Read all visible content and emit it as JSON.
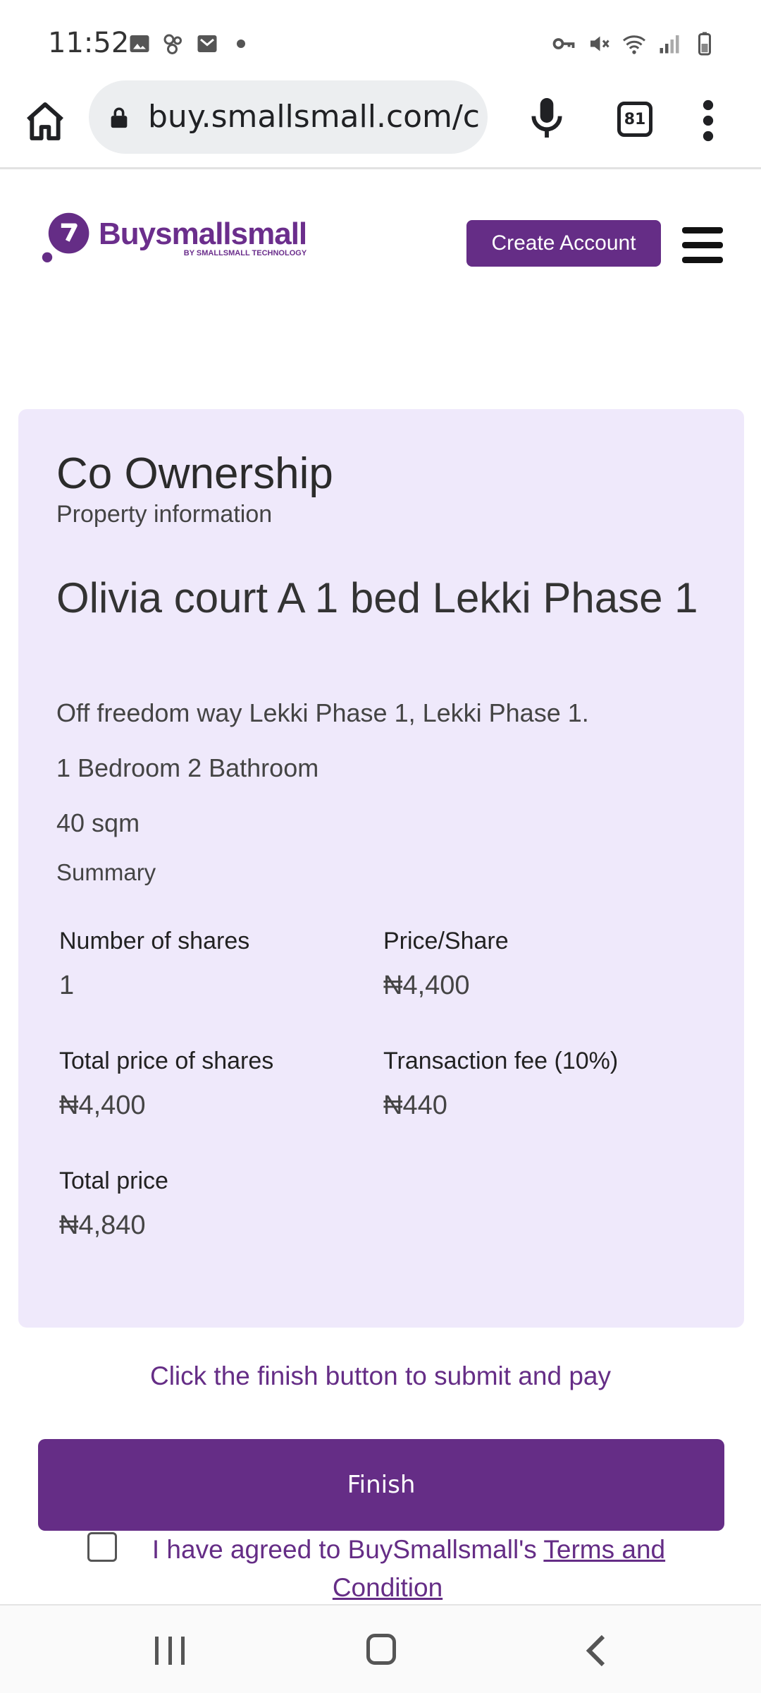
{
  "status_bar": {
    "time": "11:52"
  },
  "browser": {
    "url": "buy.smallsmall.com/co-ownership",
    "tab_count": "81"
  },
  "header": {
    "logo_text": "Buysmallsmall",
    "logo_subtext": "BY SMALLSMALL TECHNOLOGY",
    "create_account_label": "Create Account",
    "brand_color": "#652d86"
  },
  "card": {
    "title": "Co Ownership",
    "subtitle": "Property information",
    "property_name": "Olivia court A 1 bed Lekki Phase 1",
    "address": "Off freedom way Lekki Phase 1, Lekki Phase 1.",
    "rooms": "1 Bedroom 2 Bathroom",
    "size": "40 sqm",
    "summary_label": "Summary",
    "summary": {
      "shares_label": "Number of shares",
      "shares_value": "1",
      "price_share_label": "Price/Share",
      "price_share_value": "₦4,400",
      "total_shares_label": "Total price of shares",
      "total_shares_value": "₦4,400",
      "fee_label": "Transaction fee (10%)",
      "fee_value": "₦440",
      "total_label": "Total price",
      "total_value": "₦4,840"
    }
  },
  "footer": {
    "hint": "Click the finish button to submit and pay",
    "finish_label": "Finish",
    "agree_text": "I have agreed to BuySmallsmall's ",
    "terms_link": "Terms and Condition",
    "agree_checked": false
  }
}
